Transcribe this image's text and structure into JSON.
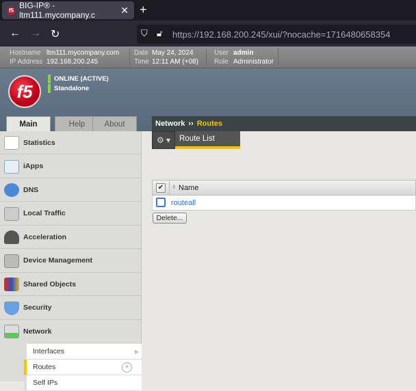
{
  "browser": {
    "tab_title": "BIG-IP® - ltm111.mycompany.c",
    "url_host": "https://192.168.200.245",
    "url_path": "/xui/?nocache=1716480658354"
  },
  "info": {
    "hostname_label": "Hostname",
    "hostname": "ltm111.mycompany.com",
    "ip_label": "IP Address",
    "ip": "192.168.200.245",
    "date_label": "Date",
    "date": "May 24, 2024",
    "time_label": "Time",
    "time": "12:11 AM (+08)",
    "user_label": "User",
    "user": "admin",
    "role_label": "Role",
    "role": "Administrator"
  },
  "status": {
    "online": "ONLINE (ACTIVE)",
    "mode": "Standalone"
  },
  "logo": "f5",
  "main_tabs": [
    "Main",
    "Help",
    "About"
  ],
  "sidebar": [
    "Statistics",
    "iApps",
    "DNS",
    "Local Traffic",
    "Acceleration",
    "Device Management",
    "Shared Objects",
    "Security",
    "Network"
  ],
  "submenu": [
    "Interfaces",
    "Routes",
    "Self IPs"
  ],
  "breadcrumb": {
    "section": "Network",
    "sep": "››",
    "page": "Routes"
  },
  "toolbar": {
    "tab": "Route List"
  },
  "table": {
    "header": "Name",
    "rows": [
      "routeall"
    ],
    "delete": "Delete..."
  }
}
